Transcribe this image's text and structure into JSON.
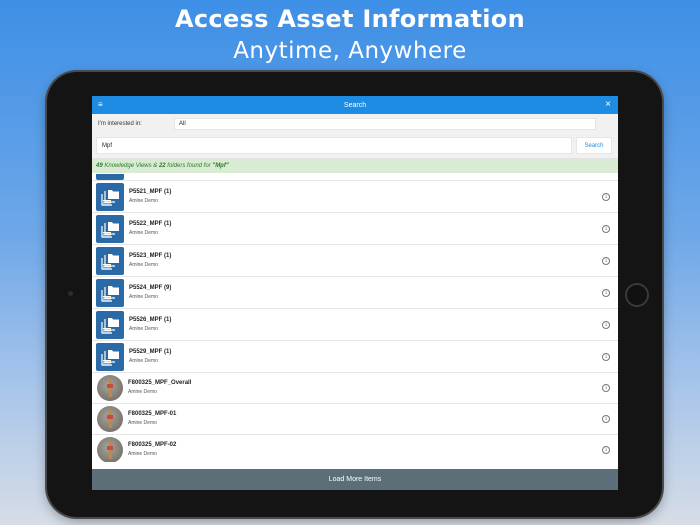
{
  "headline": {
    "line1": "Access Asset Information",
    "line2": "Anytime, Anywhere"
  },
  "app": {
    "title": "Search",
    "menu_icon": "hamburger-icon",
    "close_icon": "close-icon",
    "filter_label": "I'm interested in:",
    "filter_value": "All",
    "search_value": "Mpf",
    "search_button": "Search",
    "result": {
      "count1": "49",
      "text1": " Knowledge Views & ",
      "count2": "22",
      "text2": " folders found for ",
      "query": "\"Mpf\""
    },
    "items": [
      {
        "name": "P5521_MPF (1)",
        "sub": "Amine Demo",
        "kind": "folder"
      },
      {
        "name": "P5522_MPF (1)",
        "sub": "Amine Demo",
        "kind": "folder"
      },
      {
        "name": "P5523_MPF (1)",
        "sub": "Amine Demo",
        "kind": "folder"
      },
      {
        "name": "P5524_MPF (9)",
        "sub": "Amine Demo",
        "kind": "folder"
      },
      {
        "name": "P5526_MPF (1)",
        "sub": "Amine Demo",
        "kind": "folder"
      },
      {
        "name": "P5529_MPF (1)",
        "sub": "Amine Demo",
        "kind": "folder"
      },
      {
        "name": "F800325_MPF_Overall",
        "sub": "Amine Demo",
        "kind": "photo"
      },
      {
        "name": "F800325_MPF-01",
        "sub": "Amine Demo",
        "kind": "photo"
      },
      {
        "name": "F800325_MPF-02",
        "sub": "Amine Demo",
        "kind": "photo"
      }
    ],
    "info_glyph": "i",
    "load_more": "Load More Items"
  },
  "colors": {
    "topbar": "#1e8ce3",
    "result_bg": "#d9ecd3",
    "result_text": "#2e7a2e",
    "load_more_bg": "#5c6f78",
    "folder_icon_bg": "#2a6aa6"
  }
}
